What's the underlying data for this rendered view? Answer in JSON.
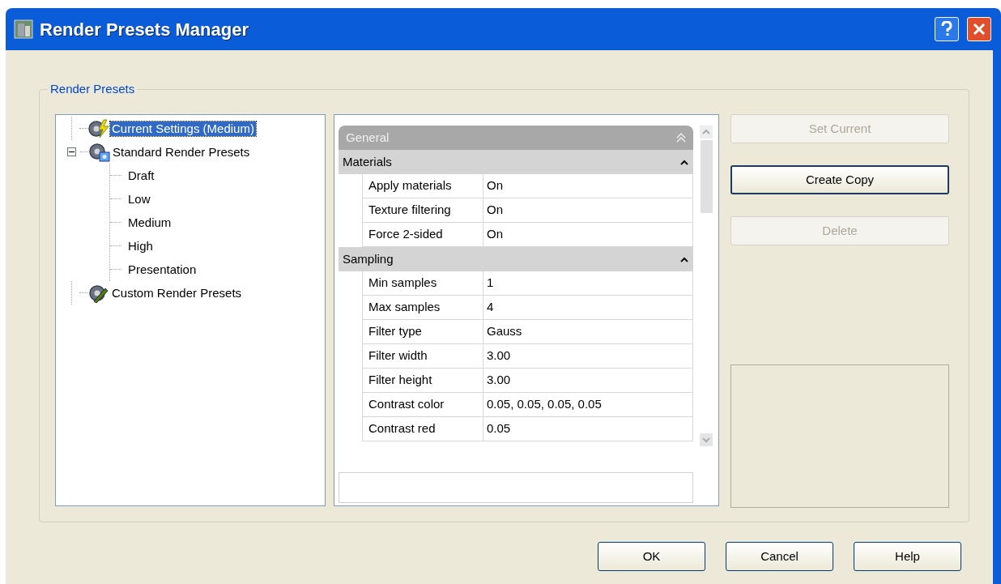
{
  "window": {
    "title": "Render Presets Manager"
  },
  "group": {
    "label": "Render Presets"
  },
  "tree": [
    {
      "label": "Current Settings (Medium)",
      "kind": "current",
      "selected": true
    },
    {
      "label": "Standard Render Presets",
      "kind": "standard",
      "selected": false,
      "expanded": true,
      "children": [
        {
          "label": "Draft",
          "selected": false
        },
        {
          "label": "Low",
          "selected": false
        },
        {
          "label": "Medium",
          "selected": false
        },
        {
          "label": "High",
          "selected": false
        },
        {
          "label": "Presentation",
          "selected": false
        }
      ]
    },
    {
      "label": "Custom Render Presets",
      "kind": "custom",
      "selected": false
    }
  ],
  "properties": {
    "header": "General",
    "sections": [
      {
        "title": "Materials",
        "expanded": true,
        "rows": [
          {
            "name": "Apply materials",
            "value": "On"
          },
          {
            "name": "Texture filtering",
            "value": "On"
          },
          {
            "name": "Force 2-sided",
            "value": "On"
          }
        ]
      },
      {
        "title": "Sampling",
        "expanded": true,
        "rows": [
          {
            "name": "Min samples",
            "value": "1"
          },
          {
            "name": "Max samples",
            "value": "4"
          },
          {
            "name": "Filter type",
            "value": "Gauss"
          },
          {
            "name": "Filter width",
            "value": "3.00"
          },
          {
            "name": "Filter height",
            "value": "3.00"
          },
          {
            "name": "Contrast color",
            "value": "0.05, 0.05, 0.05, 0.05"
          },
          {
            "name": "Contrast red",
            "value": "0.05"
          }
        ]
      }
    ]
  },
  "side_buttons": [
    {
      "label": "Set Current",
      "disabled": true,
      "default": false
    },
    {
      "label": "Create Copy",
      "disabled": false,
      "default": true
    },
    {
      "label": "Delete",
      "disabled": true,
      "default": false
    }
  ],
  "buttons": [
    {
      "label": "OK"
    },
    {
      "label": "Cancel"
    },
    {
      "label": "Help"
    }
  ]
}
